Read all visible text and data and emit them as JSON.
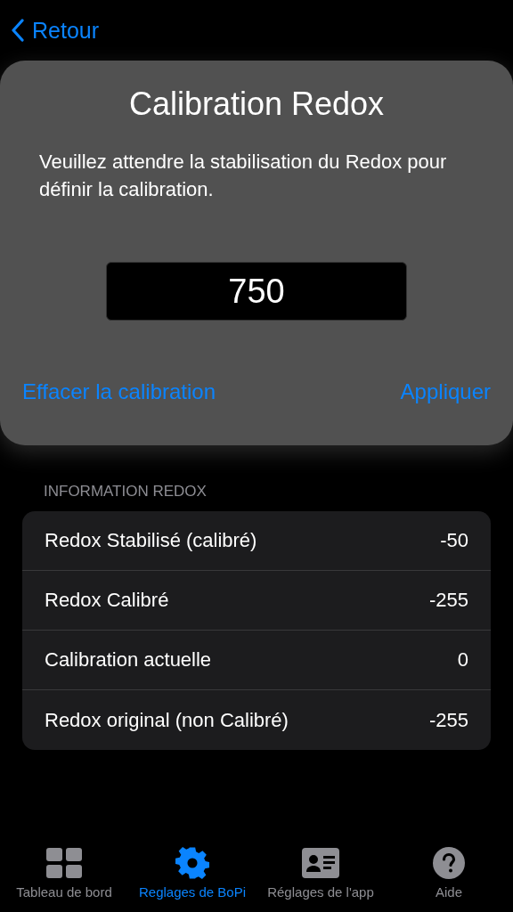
{
  "nav": {
    "back_label": "Retour"
  },
  "dialog": {
    "title": "Calibration Redox",
    "message": "Veuillez attendre la stabilisation du Redox pour définir la calibration.",
    "value": "750",
    "buttons": [
      {
        "label": "Effacer la calibration"
      },
      {
        "label": "Appliquer"
      }
    ]
  },
  "section": {
    "header": "INFORMATION REDOX",
    "rows": [
      {
        "label": "Redox Stabilisé (calibré)",
        "value": "-50"
      },
      {
        "label": "Redox Calibré",
        "value": "-255"
      },
      {
        "label": "Calibration actuelle",
        "value": "0"
      },
      {
        "label": "Redox original (non Calibré)",
        "value": "-255"
      }
    ]
  },
  "tab_bar": [
    {
      "label": "Tableau de bord",
      "kind": "grid",
      "selected": false
    },
    {
      "label": "Reglages de BoPi",
      "kind": "gear",
      "selected": true
    },
    {
      "label": "Réglages de l'app",
      "kind": "card",
      "selected": false
    },
    {
      "label": "Aide",
      "kind": "help",
      "selected": false
    }
  ]
}
